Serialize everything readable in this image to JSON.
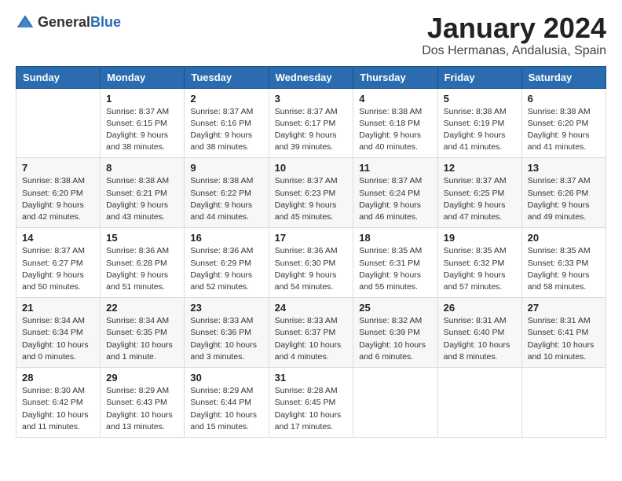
{
  "logo": {
    "text_general": "General",
    "text_blue": "Blue"
  },
  "header": {
    "month_title": "January 2024",
    "location": "Dos Hermanas, Andalusia, Spain"
  },
  "weekdays": [
    "Sunday",
    "Monday",
    "Tuesday",
    "Wednesday",
    "Thursday",
    "Friday",
    "Saturday"
  ],
  "weeks": [
    [
      {
        "day": "",
        "detail": ""
      },
      {
        "day": "1",
        "detail": "Sunrise: 8:37 AM\nSunset: 6:15 PM\nDaylight: 9 hours\nand 38 minutes."
      },
      {
        "day": "2",
        "detail": "Sunrise: 8:37 AM\nSunset: 6:16 PM\nDaylight: 9 hours\nand 38 minutes."
      },
      {
        "day": "3",
        "detail": "Sunrise: 8:37 AM\nSunset: 6:17 PM\nDaylight: 9 hours\nand 39 minutes."
      },
      {
        "day": "4",
        "detail": "Sunrise: 8:38 AM\nSunset: 6:18 PM\nDaylight: 9 hours\nand 40 minutes."
      },
      {
        "day": "5",
        "detail": "Sunrise: 8:38 AM\nSunset: 6:19 PM\nDaylight: 9 hours\nand 41 minutes."
      },
      {
        "day": "6",
        "detail": "Sunrise: 8:38 AM\nSunset: 6:20 PM\nDaylight: 9 hours\nand 41 minutes."
      }
    ],
    [
      {
        "day": "7",
        "detail": "Sunrise: 8:38 AM\nSunset: 6:20 PM\nDaylight: 9 hours\nand 42 minutes."
      },
      {
        "day": "8",
        "detail": "Sunrise: 8:38 AM\nSunset: 6:21 PM\nDaylight: 9 hours\nand 43 minutes."
      },
      {
        "day": "9",
        "detail": "Sunrise: 8:38 AM\nSunset: 6:22 PM\nDaylight: 9 hours\nand 44 minutes."
      },
      {
        "day": "10",
        "detail": "Sunrise: 8:37 AM\nSunset: 6:23 PM\nDaylight: 9 hours\nand 45 minutes."
      },
      {
        "day": "11",
        "detail": "Sunrise: 8:37 AM\nSunset: 6:24 PM\nDaylight: 9 hours\nand 46 minutes."
      },
      {
        "day": "12",
        "detail": "Sunrise: 8:37 AM\nSunset: 6:25 PM\nDaylight: 9 hours\nand 47 minutes."
      },
      {
        "day": "13",
        "detail": "Sunrise: 8:37 AM\nSunset: 6:26 PM\nDaylight: 9 hours\nand 49 minutes."
      }
    ],
    [
      {
        "day": "14",
        "detail": "Sunrise: 8:37 AM\nSunset: 6:27 PM\nDaylight: 9 hours\nand 50 minutes."
      },
      {
        "day": "15",
        "detail": "Sunrise: 8:36 AM\nSunset: 6:28 PM\nDaylight: 9 hours\nand 51 minutes."
      },
      {
        "day": "16",
        "detail": "Sunrise: 8:36 AM\nSunset: 6:29 PM\nDaylight: 9 hours\nand 52 minutes."
      },
      {
        "day": "17",
        "detail": "Sunrise: 8:36 AM\nSunset: 6:30 PM\nDaylight: 9 hours\nand 54 minutes."
      },
      {
        "day": "18",
        "detail": "Sunrise: 8:35 AM\nSunset: 6:31 PM\nDaylight: 9 hours\nand 55 minutes."
      },
      {
        "day": "19",
        "detail": "Sunrise: 8:35 AM\nSunset: 6:32 PM\nDaylight: 9 hours\nand 57 minutes."
      },
      {
        "day": "20",
        "detail": "Sunrise: 8:35 AM\nSunset: 6:33 PM\nDaylight: 9 hours\nand 58 minutes."
      }
    ],
    [
      {
        "day": "21",
        "detail": "Sunrise: 8:34 AM\nSunset: 6:34 PM\nDaylight: 10 hours\nand 0 minutes."
      },
      {
        "day": "22",
        "detail": "Sunrise: 8:34 AM\nSunset: 6:35 PM\nDaylight: 10 hours\nand 1 minute."
      },
      {
        "day": "23",
        "detail": "Sunrise: 8:33 AM\nSunset: 6:36 PM\nDaylight: 10 hours\nand 3 minutes."
      },
      {
        "day": "24",
        "detail": "Sunrise: 8:33 AM\nSunset: 6:37 PM\nDaylight: 10 hours\nand 4 minutes."
      },
      {
        "day": "25",
        "detail": "Sunrise: 8:32 AM\nSunset: 6:39 PM\nDaylight: 10 hours\nand 6 minutes."
      },
      {
        "day": "26",
        "detail": "Sunrise: 8:31 AM\nSunset: 6:40 PM\nDaylight: 10 hours\nand 8 minutes."
      },
      {
        "day": "27",
        "detail": "Sunrise: 8:31 AM\nSunset: 6:41 PM\nDaylight: 10 hours\nand 10 minutes."
      }
    ],
    [
      {
        "day": "28",
        "detail": "Sunrise: 8:30 AM\nSunset: 6:42 PM\nDaylight: 10 hours\nand 11 minutes."
      },
      {
        "day": "29",
        "detail": "Sunrise: 8:29 AM\nSunset: 6:43 PM\nDaylight: 10 hours\nand 13 minutes."
      },
      {
        "day": "30",
        "detail": "Sunrise: 8:29 AM\nSunset: 6:44 PM\nDaylight: 10 hours\nand 15 minutes."
      },
      {
        "day": "31",
        "detail": "Sunrise: 8:28 AM\nSunset: 6:45 PM\nDaylight: 10 hours\nand 17 minutes."
      },
      {
        "day": "",
        "detail": ""
      },
      {
        "day": "",
        "detail": ""
      },
      {
        "day": "",
        "detail": ""
      }
    ]
  ]
}
